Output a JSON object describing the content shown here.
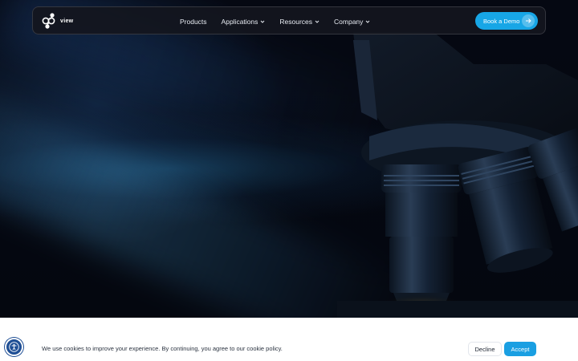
{
  "brand": {
    "logo_text": "view"
  },
  "nav": {
    "items": [
      {
        "label": "Products",
        "has_dropdown": false
      },
      {
        "label": "Applications",
        "has_dropdown": true
      },
      {
        "label": "Resources",
        "has_dropdown": true
      },
      {
        "label": "Company",
        "has_dropdown": true
      }
    ],
    "cta_label": "Book a Demo",
    "cta_icon": "arrow-right-icon"
  },
  "hero": {
    "image": "microscope-objectives-dark-blue"
  },
  "cookie_banner": {
    "message": "We use cookies to improve your experience. By continuing, you agree to our cookie policy.",
    "decline_label": "Decline",
    "accept_label": "Accept"
  },
  "accessibility": {
    "icon": "accessibility-icon"
  },
  "colors": {
    "accent": "#17a6e6",
    "accept": "#1a9fe2",
    "hero_bg": "#04070f",
    "navbar_bg": "#14161e",
    "accessibility_bg": "#1f4f95"
  }
}
